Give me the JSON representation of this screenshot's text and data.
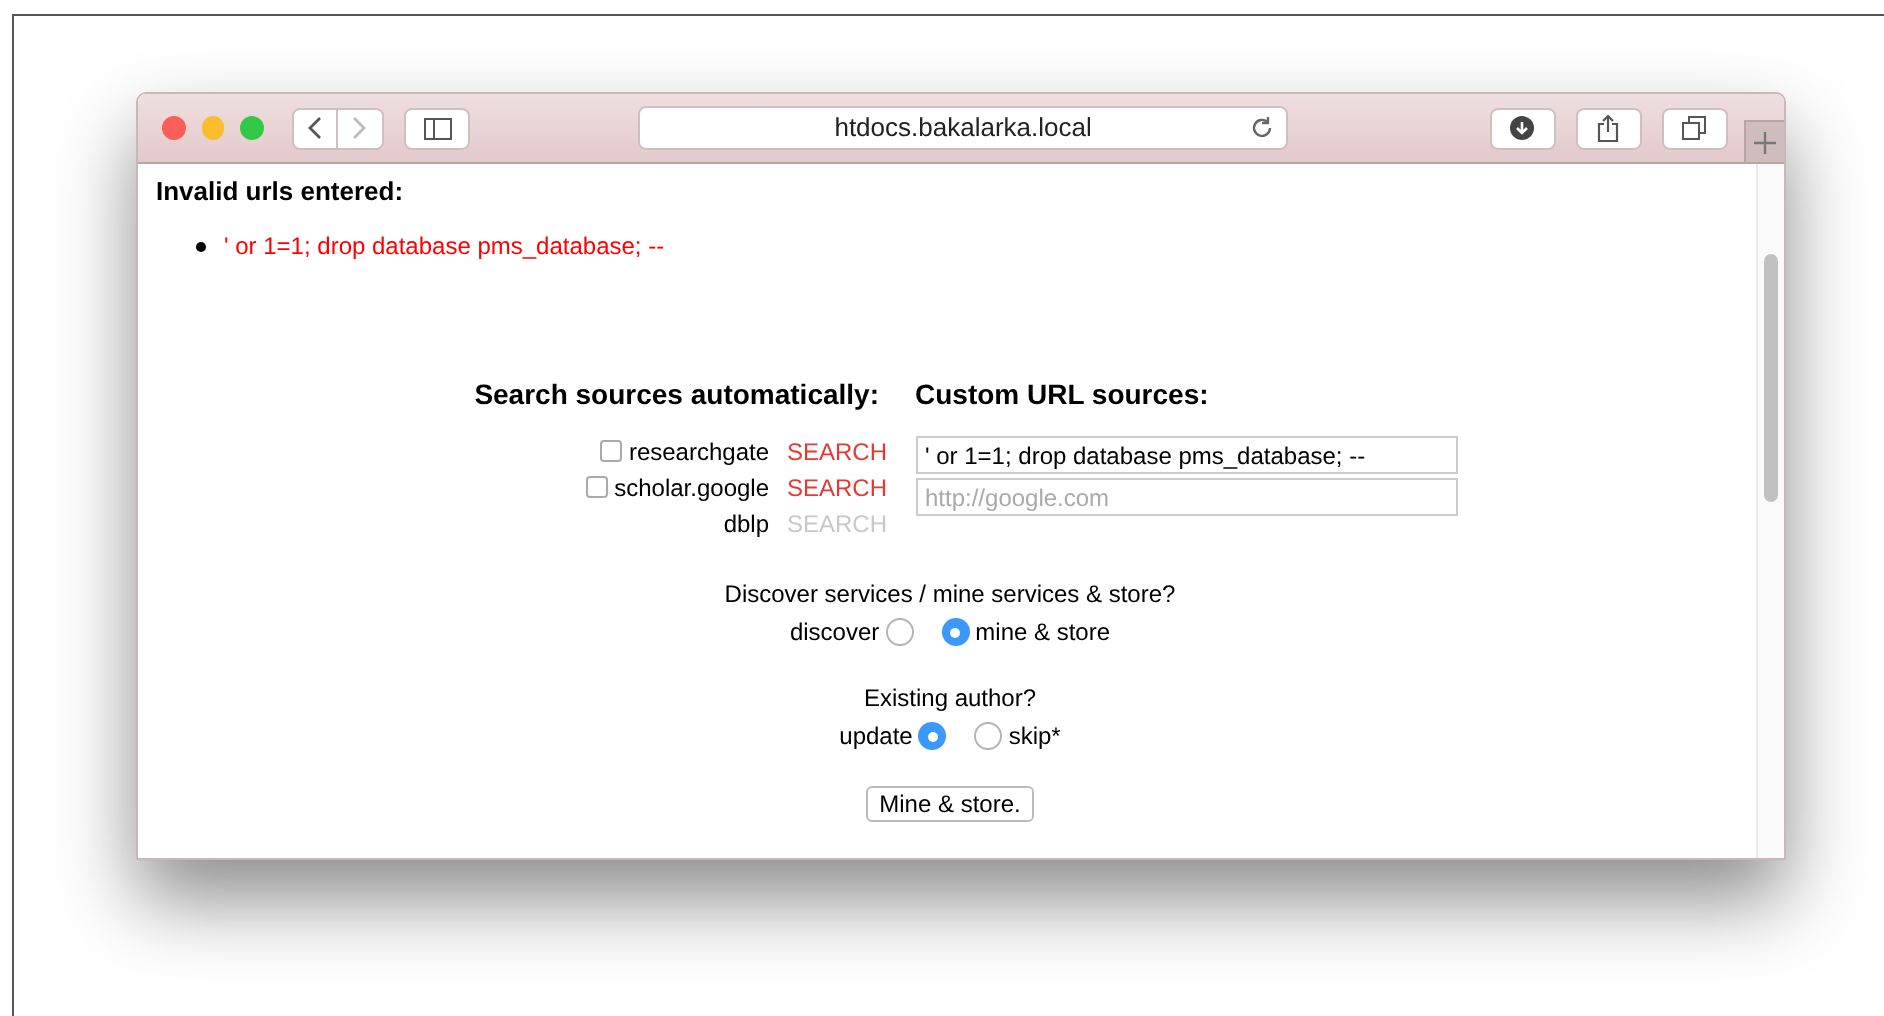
{
  "browser": {
    "address": "htdocs.bakalarka.local"
  },
  "invalid": {
    "heading": "Invalid urls entered:",
    "items": [
      "' or 1=1; drop database pms_database; --"
    ]
  },
  "search_sources": {
    "heading": "Search sources automatically:",
    "sources": [
      {
        "kind": "checkbox",
        "name": "researchgate",
        "checked": false,
        "action": "SEARCH",
        "disabled": false
      },
      {
        "kind": "checkbox",
        "name": "scholar.google",
        "checked": false,
        "action": "SEARCH",
        "disabled": false
      },
      {
        "kind": "plain",
        "name": "dblp",
        "action": "SEARCH",
        "disabled": true
      }
    ]
  },
  "custom_sources": {
    "heading": "Custom URL sources:",
    "fields": [
      {
        "value": "' or 1=1; drop database pms_database; --"
      },
      {
        "placeholder": "http://google.com"
      }
    ]
  },
  "radio_groups": [
    {
      "question": "Discover services / mine services & store?",
      "options": [
        {
          "label": "discover",
          "kind": "label-first",
          "selected": false
        },
        {
          "label": "mine & store",
          "kind": "label-last",
          "selected": true
        }
      ]
    },
    {
      "question": "Existing author?",
      "options": [
        {
          "label": "update",
          "kind": "label-first",
          "selected": true
        },
        {
          "label": "skip*",
          "kind": "label-last",
          "selected": false
        }
      ]
    }
  ],
  "submit": "Mine & store."
}
